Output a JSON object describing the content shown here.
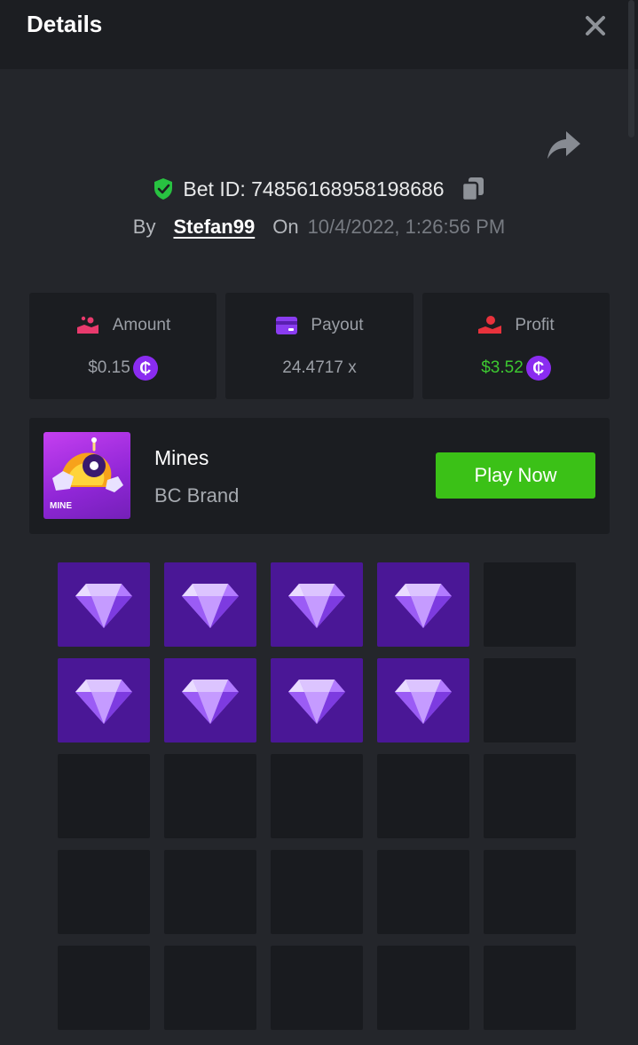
{
  "header": {
    "title": "Details"
  },
  "bet": {
    "id_label": "Bet ID: 74856168958198686",
    "by_label": "By",
    "username": "Stefan99",
    "on_label": "On",
    "date": "10/4/2022, 1:26:56 PM"
  },
  "stats": {
    "amount": {
      "label": "Amount",
      "value": "$0.15",
      "icon": "hand-coins-icon"
    },
    "payout": {
      "label": "Payout",
      "value": "24.4717 x",
      "icon": "card-icon"
    },
    "profit": {
      "label": "Profit",
      "value": "$3.52",
      "icon": "hand-user-icon"
    },
    "currency_symbol": "₵"
  },
  "game": {
    "name": "Mines",
    "brand": "BC Brand",
    "thumb_label": "MINE",
    "play_label": "Play Now"
  },
  "grid": {
    "rows": 5,
    "cols": 5,
    "tiles": [
      "gem",
      "gem",
      "gem",
      "gem",
      "empty",
      "gem",
      "gem",
      "gem",
      "gem",
      "empty",
      "empty",
      "empty",
      "empty",
      "empty",
      "empty",
      "empty",
      "empty",
      "empty",
      "empty",
      "empty",
      "empty",
      "empty",
      "empty",
      "empty",
      "empty"
    ]
  },
  "colors": {
    "background": "#24262b",
    "card": "#1b1d21",
    "gem_tile": "#4a1796",
    "play_button": "#3bc117",
    "profit_green": "#3dc831",
    "coin_purple": "#8a2cf0",
    "shield_green": "#28c241"
  }
}
